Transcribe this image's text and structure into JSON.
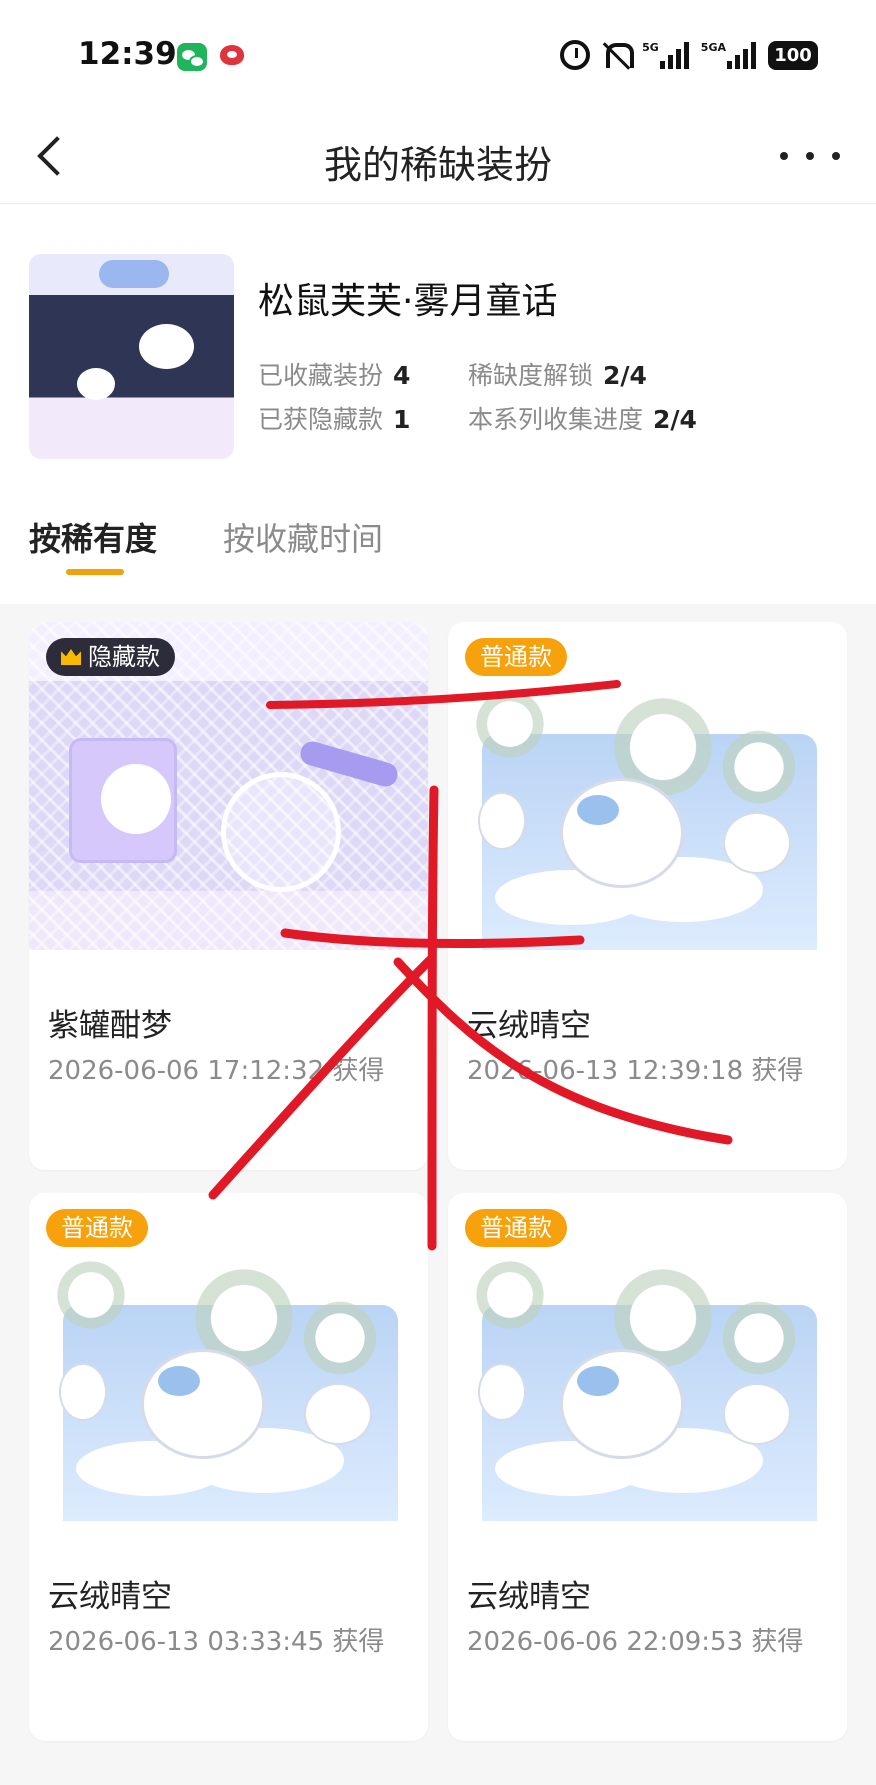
{
  "status_bar": {
    "time": "12:39",
    "signal_5g": "5G",
    "signal_5ga": "5GA",
    "battery": "100"
  },
  "header": {
    "title": "我的稀缺装扮"
  },
  "summary": {
    "title": "松鼠芙芙·雾月童话",
    "stats": {
      "collected_label": "已收藏装扮",
      "collected_value": "4",
      "rarity_unlock_label": "稀缺度解锁",
      "rarity_unlock_value": "2/4",
      "hidden_label": "已获隐藏款",
      "hidden_value": "1",
      "progress_label": "本系列收集进度",
      "progress_value": "2/4"
    }
  },
  "tabs": [
    {
      "label": "按稀有度",
      "active": true
    },
    {
      "label": "按收藏时间",
      "active": false
    }
  ],
  "cards": [
    {
      "badge": "隐藏款",
      "name": "紫罐酣梦",
      "time": "2026-06-06 17:12:32 获得"
    },
    {
      "badge": "普通款",
      "name": "云绒晴空",
      "time": "2026-06-13 12:39:18 获得"
    },
    {
      "badge": "普通款",
      "name": "云绒晴空",
      "time": "2026-06-13 03:33:45 获得"
    },
    {
      "badge": "普通款",
      "name": "云绒晴空",
      "time": "2026-06-06 22:09:53 获得"
    }
  ],
  "colors": {
    "accent": "#f7a10c",
    "hidden_badge": "#2c2c3a",
    "red_mark": "#e11826"
  },
  "icons": [
    "wechat-icon",
    "weibo-icon",
    "alarm-icon",
    "bell-off-icon",
    "signal-icon",
    "battery-icon",
    "back-icon",
    "more-icon",
    "crown-icon"
  ]
}
